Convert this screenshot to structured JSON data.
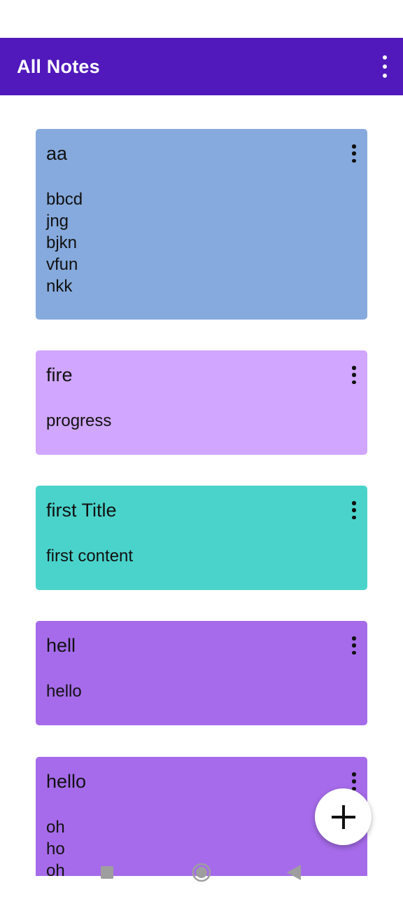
{
  "app_bar": {
    "title": "All Notes",
    "bg": "#5119bb",
    "overflow_icon": "more-vert-icon"
  },
  "notes": [
    {
      "title": "aa",
      "content": "bbcd\njng\nbjkn\nvfun\nnkk",
      "color": "#86aadd"
    },
    {
      "title": "fire",
      "content": "progress",
      "color": "#d0a6ff"
    },
    {
      "title": "first Title",
      "content": "first content",
      "color": "#4ad3cb"
    },
    {
      "title": "hell",
      "content": "hello",
      "color": "#a66bea"
    },
    {
      "title": "hello",
      "content": "oh\nho\noh",
      "color": "#a66bea"
    }
  ],
  "fab": {
    "icon": "plus-icon"
  },
  "nav": {
    "recents_icon": "square-icon",
    "home_icon": "circle-icon",
    "back_icon": "triangle-back-icon"
  }
}
